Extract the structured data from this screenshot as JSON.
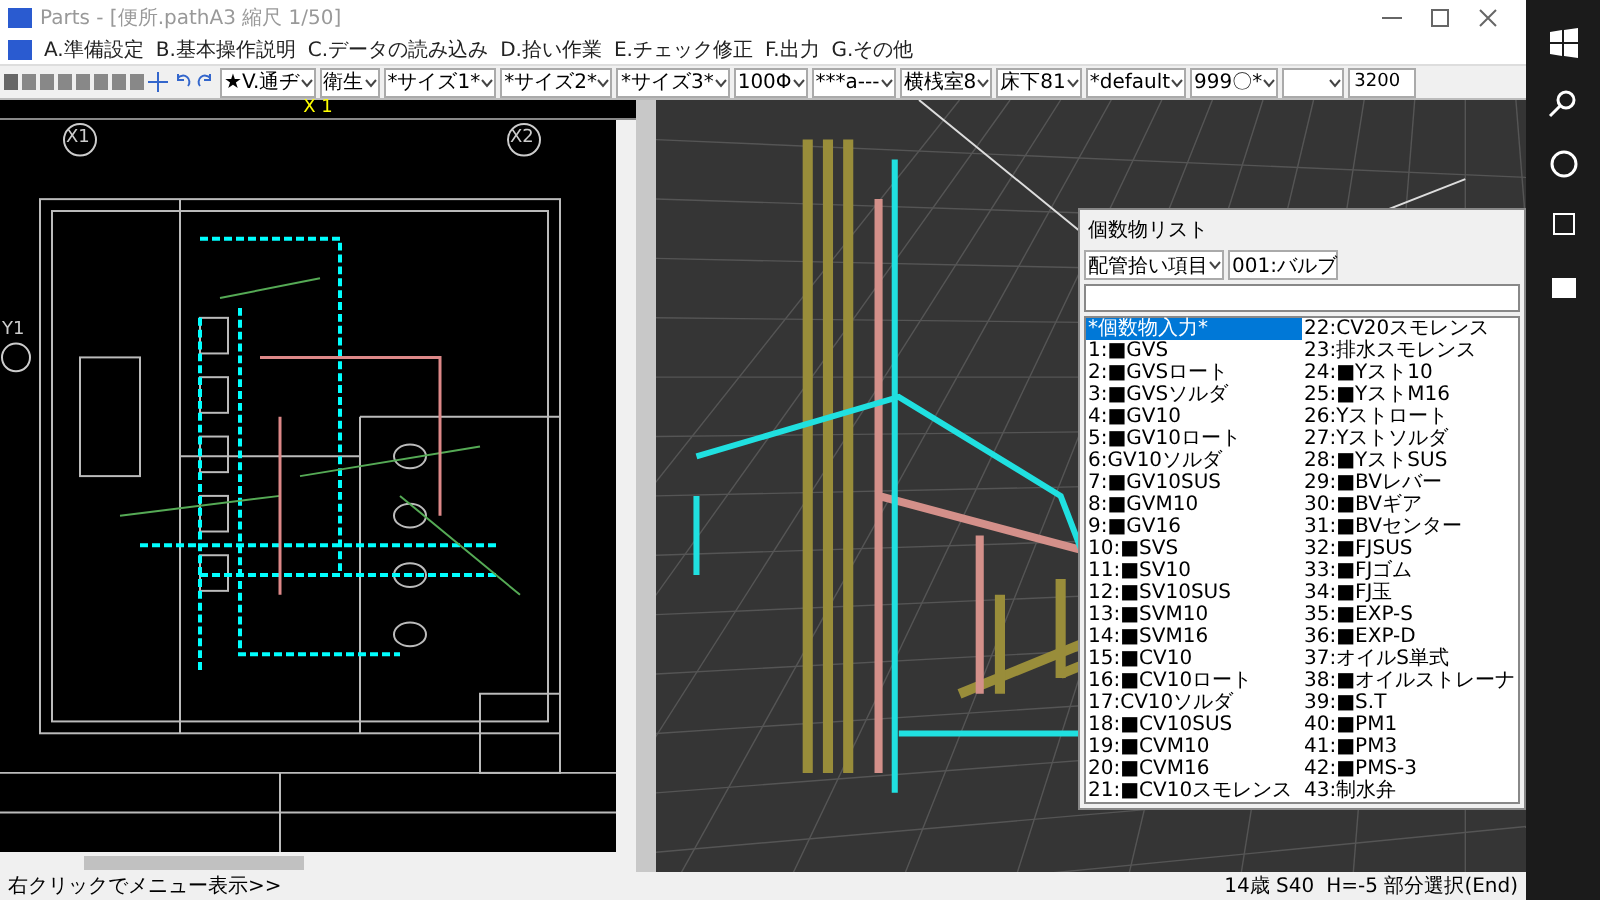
{
  "window": {
    "title": "Parts - [便所.pathA3 縮尺 1/50]"
  },
  "menu": [
    "A.準備設定",
    "B.基本操作説明",
    "C.データの読み込み",
    "D.拾い作業",
    "E.チェック修正",
    "F.出力",
    "G.その他"
  ],
  "toolbar": {
    "combos": [
      "★V.通ヂ",
      "衛生",
      "*サイズ1*",
      "*サイズ2*",
      "*サイズ3*",
      "100Φ",
      "***a---",
      "横桟室8",
      "床下81",
      "*default",
      "999〇*"
    ],
    "field": "3200"
  },
  "plan": {
    "ruler_label": "X 1",
    "grid_labels": [
      "X1",
      "X2",
      "Y1"
    ]
  },
  "list_panel": {
    "title": "個数物リスト",
    "category": "配管拾い項目",
    "filter": "001:バルブ",
    "items": [
      {
        "label": "*個数物入力*",
        "selected": true
      },
      {
        "label": "1:■GVS",
        "selected": false
      },
      {
        "label": "2:■GVSロート",
        "selected": false
      },
      {
        "label": "3:■GVSソルダ",
        "selected": false
      },
      {
        "label": "4:■GV10",
        "selected": false
      },
      {
        "label": "5:■GV10ロート",
        "selected": false
      },
      {
        "label": "6:GV10ソルダ",
        "selected": false
      },
      {
        "label": "7:■GV10SUS",
        "selected": false
      },
      {
        "label": "8:■GVM10",
        "selected": false
      },
      {
        "label": "9:■GV16",
        "selected": false
      },
      {
        "label": "10:■SVS",
        "selected": false
      },
      {
        "label": "11:■SV10",
        "selected": false
      },
      {
        "label": "12:■SV10SUS",
        "selected": false
      },
      {
        "label": "13:■SVM10",
        "selected": false
      },
      {
        "label": "14:■SVM16",
        "selected": false
      },
      {
        "label": "15:■CV10",
        "selected": false
      },
      {
        "label": "16:■CV10ロート",
        "selected": false
      },
      {
        "label": "17:CV10ソルダ",
        "selected": false
      },
      {
        "label": "18:■CV10SUS",
        "selected": false
      },
      {
        "label": "19:■CVM10",
        "selected": false
      },
      {
        "label": "20:■CVM16",
        "selected": false
      },
      {
        "label": "21:■CV10スモレンス",
        "selected": false
      },
      {
        "label": "22:CV20スモレンス",
        "selected": false
      },
      {
        "label": "23:排水スモレンス",
        "selected": false
      },
      {
        "label": "24:■Yスト10",
        "selected": false
      },
      {
        "label": "25:■YストM16",
        "selected": false
      },
      {
        "label": "26:Yストロート",
        "selected": false
      },
      {
        "label": "27:Yストソルダ",
        "selected": false
      },
      {
        "label": "28:■YストSUS",
        "selected": false
      },
      {
        "label": "29:■BVレバー",
        "selected": false
      },
      {
        "label": "30:■BVギア",
        "selected": false
      },
      {
        "label": "31:■BVセンター",
        "selected": false
      },
      {
        "label": "32:■FJSUS",
        "selected": false
      },
      {
        "label": "33:■FJゴム",
        "selected": false
      },
      {
        "label": "34:■FJ玉",
        "selected": false
      },
      {
        "label": "35:■EXP-S",
        "selected": false
      },
      {
        "label": "36:■EXP-D",
        "selected": false
      },
      {
        "label": "37:オイルS単式",
        "selected": false
      },
      {
        "label": "38:■オイルストレーナ",
        "selected": false
      },
      {
        "label": "39:■S.T",
        "selected": false
      },
      {
        "label": "40:■PM1",
        "selected": false
      },
      {
        "label": "41:■PM3",
        "selected": false
      },
      {
        "label": "42:■PMS-3",
        "selected": false
      },
      {
        "label": "43:制水弁",
        "selected": false
      }
    ]
  },
  "status_bar": {
    "hint": "右クリックでメニュー表示>>",
    "scale": "14歳 S40",
    "mode": "H=-5 部分選択(End)"
  }
}
